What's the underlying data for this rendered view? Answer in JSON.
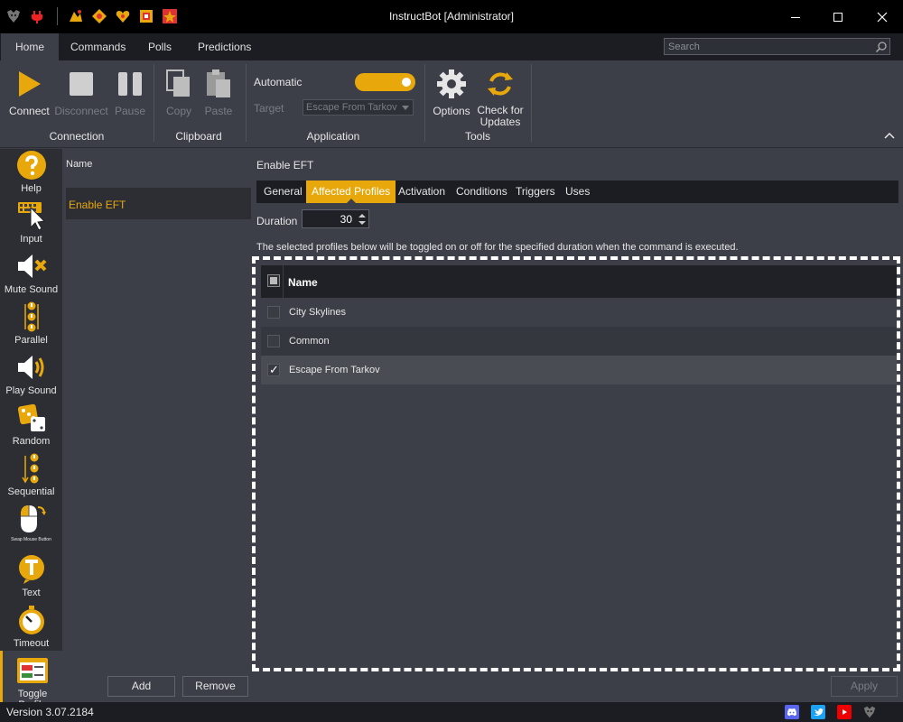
{
  "window": {
    "title": "InstructBot [Administrator]"
  },
  "menu": {
    "tabs": [
      "Home",
      "Commands",
      "Polls",
      "Predictions"
    ],
    "search_placeholder": "Search"
  },
  "ribbon": {
    "connection": {
      "label": "Connection",
      "connect": "Connect",
      "disconnect": "Disconnect",
      "pause": "Pause"
    },
    "clipboard": {
      "label": "Clipboard",
      "copy": "Copy",
      "paste": "Paste"
    },
    "application": {
      "label": "Application",
      "automatic": "Automatic",
      "target": "Target",
      "target_value": "Escape From Tarkov",
      "automatic_on": true
    },
    "tools": {
      "label": "Tools",
      "options": "Options",
      "check_updates_line1": "Check for",
      "check_updates_line2": "Updates"
    }
  },
  "sidebar": {
    "items": [
      "Help",
      "Input",
      "Mute Sound",
      "Parallel",
      "Play Sound",
      "Random",
      "Sequential",
      "Swap Mouse Button",
      "Text",
      "Timeout",
      "Toggle Profile"
    ]
  },
  "command_list": {
    "header": "Name",
    "items": [
      "Enable EFT"
    ],
    "add": "Add",
    "remove": "Remove"
  },
  "editor": {
    "title": "Enable EFT",
    "tabs": [
      "General",
      "Affected Profiles",
      "Activation",
      "Conditions",
      "Triggers",
      "Uses"
    ],
    "active_tab": "Affected Profiles",
    "duration_label": "Duration",
    "duration_value": "30",
    "description": "The selected profiles below will be toggled on or off for the specified duration when the command is executed.",
    "profiles_header": "Name",
    "profiles": [
      {
        "name": "City Skylines",
        "checked": false
      },
      {
        "name": "Common",
        "checked": false
      },
      {
        "name": "Escape From Tarkov",
        "checked": true
      }
    ],
    "apply": "Apply"
  },
  "status": {
    "version": "Version 3.07.2184"
  },
  "colors": {
    "accent": "#e8a80c",
    "background": "#3c3f48",
    "dark": "#1b1d22"
  }
}
